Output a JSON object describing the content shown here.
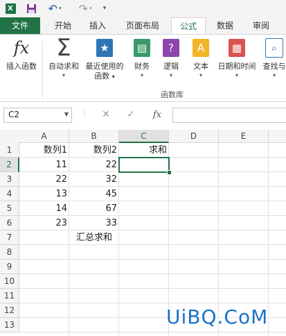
{
  "qat": {
    "app_icon": "excel-app-icon",
    "save_icon": "save-icon",
    "undo_icon": "undo-icon",
    "redo_icon": "redo-icon",
    "customize_icon": "customize-qat-icon"
  },
  "tabs": [
    {
      "label": "文件",
      "active": false
    },
    {
      "label": "开始",
      "active": false
    },
    {
      "label": "插入",
      "active": false
    },
    {
      "label": "页面布局",
      "active": false
    },
    {
      "label": "公式",
      "active": true
    },
    {
      "label": "数据",
      "active": false
    },
    {
      "label": "审阅",
      "active": false
    }
  ],
  "ribbon": {
    "insert_function": "插入函数",
    "autosum": "自动求和",
    "recent_line1": "最近使用的",
    "recent_line2": "函数",
    "financial": "财务",
    "logical": "逻辑",
    "text": "文本",
    "datetime": "日期和时间",
    "lookup": "查找与",
    "group_label": "函数库"
  },
  "formula_bar": {
    "name_box": "C2",
    "cancel": "✕",
    "enter": "✓",
    "fx": "fx",
    "formula": ""
  },
  "grid": {
    "columns": [
      "A",
      "B",
      "C",
      "D",
      "E"
    ],
    "rows": [
      "1",
      "2",
      "3",
      "4",
      "5",
      "6",
      "7",
      "8",
      "9",
      "10",
      "11",
      "12",
      "13"
    ],
    "cells": {
      "A1": "数列1",
      "B1": "数列2",
      "C1": "求和",
      "A2": "11",
      "B2": "22",
      "A3": "22",
      "B3": "32",
      "A4": "13",
      "B4": "45",
      "A5": "14",
      "B5": "67",
      "A6": "23",
      "B6": "33",
      "B7": "汇总求和"
    },
    "active_cell": "C2"
  },
  "watermark": "UiBQ.CoM",
  "colors": {
    "accent": "#217346",
    "watermark": "#1a73c9"
  }
}
